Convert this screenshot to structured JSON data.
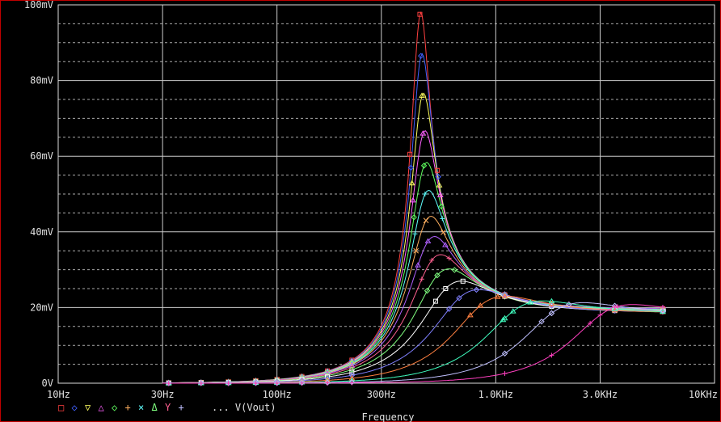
{
  "chart_data": {
    "type": "line",
    "xscale": "log",
    "xlim": [
      10,
      10000
    ],
    "ylim": [
      0,
      100
    ],
    "grid": true,
    "xlabel": "Frequency",
    "ylabel": "",
    "x_ticks": [
      "10Hz",
      "30Hz",
      "100Hz",
      "300Hz",
      "1.0KHz",
      "3.0KHz",
      "10KHz"
    ],
    "x_tick_values": [
      10,
      30,
      100,
      300,
      1000,
      3000,
      10000
    ],
    "y_ticks": [
      "0V",
      "20mV",
      "40mV",
      "60mV",
      "80mV",
      "100mV"
    ],
    "y_tick_values": [
      0,
      20,
      40,
      60,
      80,
      100
    ],
    "legend": {
      "markers": [
        "□",
        "◇",
        "▽",
        "△",
        "◇",
        "+",
        "×",
        "Δ",
        "Y",
        "+"
      ],
      "trace_label": "... V(Vout)"
    },
    "colors": [
      "#ff4040",
      "#4060ff",
      "#ffff60",
      "#ff60ff",
      "#60ff60",
      "#60ffff",
      "#ffb060",
      "#b060ff",
      "#ff6090",
      "#80ff80",
      "#ffffff",
      "#8080ff",
      "#ff8040",
      "#40ffc0",
      "#c0c0ff",
      "#ff40c0"
    ],
    "series": [
      {
        "peak_freq": 450,
        "peak_mv": 97.5,
        "hf_mv": 19.6
      },
      {
        "peak_freq": 455,
        "peak_mv": 86.5,
        "hf_mv": 19.6
      },
      {
        "peak_freq": 460,
        "peak_mv": 76,
        "hf_mv": 19.5
      },
      {
        "peak_freq": 465,
        "peak_mv": 66,
        "hf_mv": 19.5
      },
      {
        "peak_freq": 470,
        "peak_mv": 57.5,
        "hf_mv": 19.4
      },
      {
        "peak_freq": 475,
        "peak_mv": 50,
        "hf_mv": 19.3
      },
      {
        "peak_freq": 480,
        "peak_mv": 43,
        "hf_mv": 19.2
      },
      {
        "peak_freq": 490,
        "peak_mv": 37.5,
        "hf_mv": 19.1
      },
      {
        "peak_freq": 510,
        "peak_mv": 32.5,
        "hf_mv": 19.0
      },
      {
        "peak_freq": 540,
        "peak_mv": 28.5,
        "hf_mv": 18.9
      },
      {
        "peak_freq": 590,
        "peak_mv": 25,
        "hf_mv": 18.8
      },
      {
        "peak_freq": 680,
        "peak_mv": 22.5,
        "hf_mv": 18.7
      },
      {
        "peak_freq": 850,
        "peak_mv": 20.5,
        "hf_mv": 18.6
      },
      {
        "peak_freq": 1200,
        "peak_mv": 19,
        "hf_mv": 18.5
      },
      {
        "peak_freq": 1800,
        "peak_mv": 18.5,
        "hf_mv": 18.3
      },
      {
        "peak_freq": 3000,
        "peak_mv": 18,
        "hf_mv": 18.0
      }
    ]
  }
}
